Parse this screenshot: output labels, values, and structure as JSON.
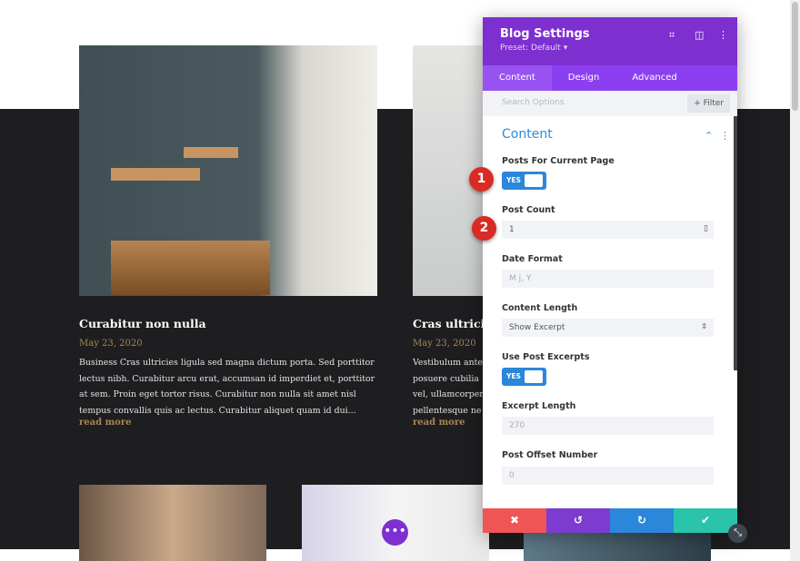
{
  "posts": [
    {
      "title": "Curabitur non nulla",
      "date": "May 23, 2020",
      "excerpt": "Business Cras ultricies ligula sed magna dictum porta. Sed porttitor lectus nibh. Curabitur arcu erat, accumsan id imperdiet et, porttitor at sem. Proin eget tortor risus. Curabitur non nulla sit amet nisl tempus convallis quis ac lectus. Curabitur aliquet quam id dui...",
      "more": "read more"
    },
    {
      "title": "Cras ultricies",
      "date": "May 23, 2020",
      "excerpt": "Vestibulum ante posuere cubilia vel, ullamcorper pellentesque ne",
      "more": "read more"
    }
  ],
  "panel": {
    "title": "Blog Settings",
    "preset": "Preset: Default ▾",
    "icons": [
      "focus-icon",
      "split-view-icon",
      "more-icon"
    ],
    "tabs": [
      "Content",
      "Design",
      "Advanced"
    ],
    "search_placeholder": "Search Options",
    "filter": "+ Filter",
    "section": "Content",
    "fields": {
      "posts_current_page": {
        "label": "Posts For Current Page",
        "value": "YES"
      },
      "post_count": {
        "label": "Post Count",
        "value": "1"
      },
      "date_format": {
        "label": "Date Format",
        "placeholder": "M j, Y"
      },
      "content_length": {
        "label": "Content Length",
        "value": "Show Excerpt"
      },
      "use_excerpts": {
        "label": "Use Post Excerpts",
        "value": "YES"
      },
      "excerpt_length": {
        "label": "Excerpt Length",
        "placeholder": "270"
      },
      "offset": {
        "label": "Post Offset Number",
        "placeholder": "0"
      }
    },
    "footer": {
      "cancel": "✖",
      "undo": "↺",
      "redo": "↻",
      "save": "✔"
    },
    "colors": {
      "header": "#7d2fd0",
      "cancel": "#ef5555",
      "undo": "#7d3bcf",
      "redo": "#2b87da",
      "save": "#29c4a9"
    }
  },
  "badges": [
    "1",
    "2"
  ],
  "dots": "•••",
  "resize": "⤡"
}
